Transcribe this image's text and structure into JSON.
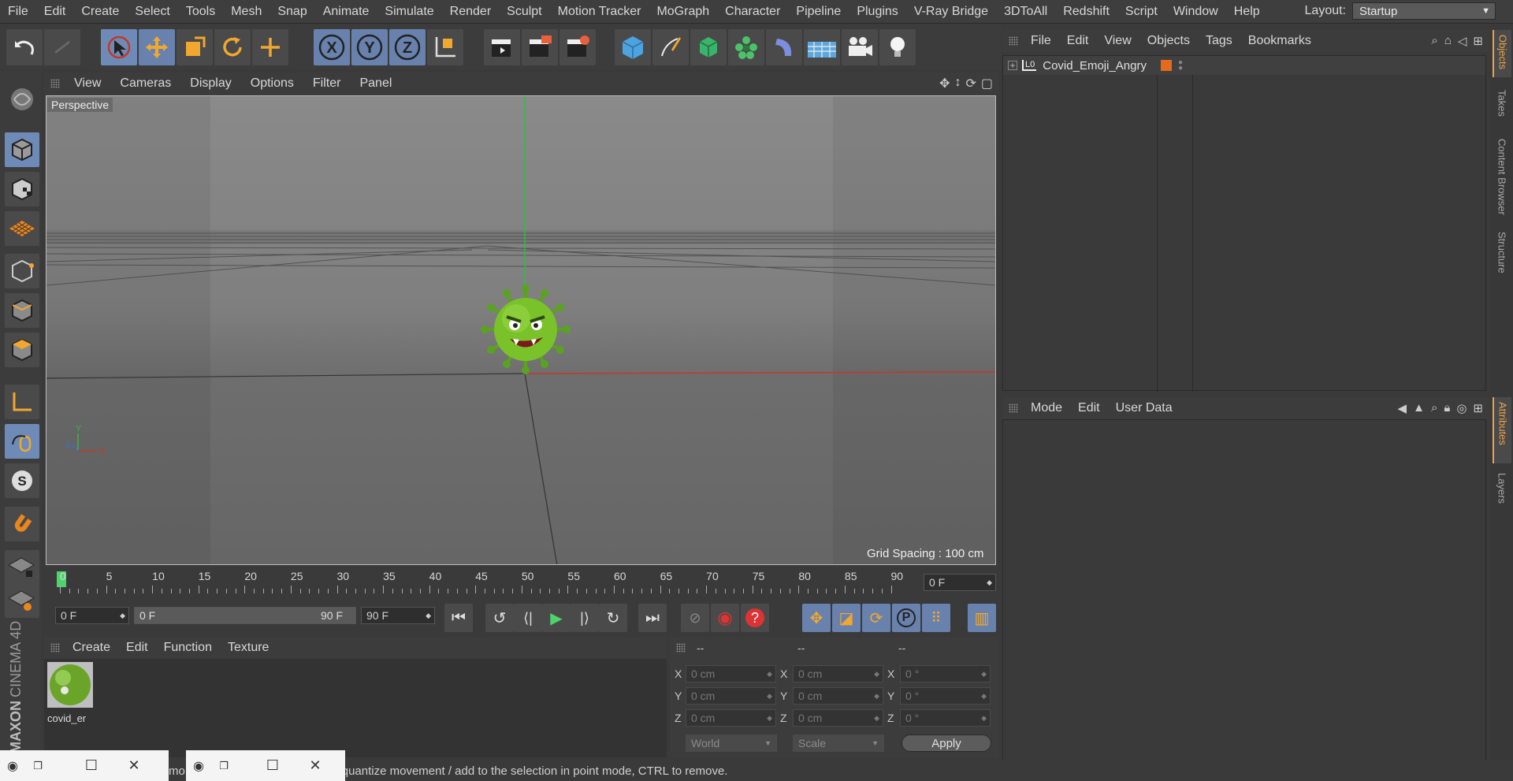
{
  "menubar": {
    "items": [
      "File",
      "Edit",
      "Create",
      "Select",
      "Tools",
      "Mesh",
      "Snap",
      "Animate",
      "Simulate",
      "Render",
      "Sculpt",
      "Motion Tracker",
      "MoGraph",
      "Character",
      "Pipeline",
      "Plugins",
      "V-Ray Bridge",
      "3DToAll",
      "Redshift",
      "Script",
      "Window",
      "Help"
    ],
    "layout_label": "Layout:",
    "layout_value": "Startup"
  },
  "toolbar": {
    "axis_x": "X",
    "axis_y": "Y",
    "axis_z": "Z"
  },
  "viewport": {
    "menu": [
      "View",
      "Cameras",
      "Display",
      "Options",
      "Filter",
      "Panel"
    ],
    "label": "Perspective",
    "grid_spacing": "Grid Spacing : 100 cm",
    "axis_y": "Y",
    "axis_x": "X",
    "axis_z": "Z"
  },
  "timeline": {
    "ticks": [
      "0",
      "5",
      "10",
      "15",
      "20",
      "25",
      "30",
      "35",
      "40",
      "45",
      "50",
      "55",
      "60",
      "65",
      "70",
      "75",
      "80",
      "85",
      "90"
    ],
    "current_frame": "0 F",
    "start_field": "0 F",
    "range_start": "0 F",
    "range_end": "90 F",
    "end_field": "90 F"
  },
  "materials": {
    "menu": [
      "Create",
      "Edit",
      "Function",
      "Texture"
    ],
    "material_name": "covid_er"
  },
  "coords": {
    "header": [
      "--",
      "--",
      "--"
    ],
    "rows": [
      {
        "axis": "X",
        "pos": "0 cm",
        "size": "0 cm",
        "rot": "0 °"
      },
      {
        "axis": "Y",
        "pos": "0 cm",
        "size": "0 cm",
        "rot": "0 °"
      },
      {
        "axis": "Z",
        "pos": "0 cm",
        "size": "0 cm",
        "rot": "0 °"
      }
    ],
    "world": "World",
    "scale": "Scale",
    "apply": "Apply"
  },
  "objects": {
    "menu": [
      "File",
      "Edit",
      "View",
      "Objects",
      "Tags",
      "Bookmarks"
    ],
    "item_name": "Covid_Emoji_Angry",
    "item_layer_icon": "L0"
  },
  "attributes": {
    "menu": [
      "Mode",
      "Edit",
      "User Data"
    ]
  },
  "side_tabs": [
    "Objects",
    "Takes",
    "Content Browser",
    "Structure",
    "Attributes",
    "Layers"
  ],
  "status": {
    "text_left": "mo",
    "text": "FT to quantize movement / add to the selection in point mode, CTRL to remove."
  },
  "branding": {
    "maxon": "MAXON",
    "product": "CINEMA 4D"
  },
  "colors": {
    "accent_orange": "#e9a24a",
    "selected_blue": "#6e8bb8",
    "green_virus": "#7ac22a"
  }
}
